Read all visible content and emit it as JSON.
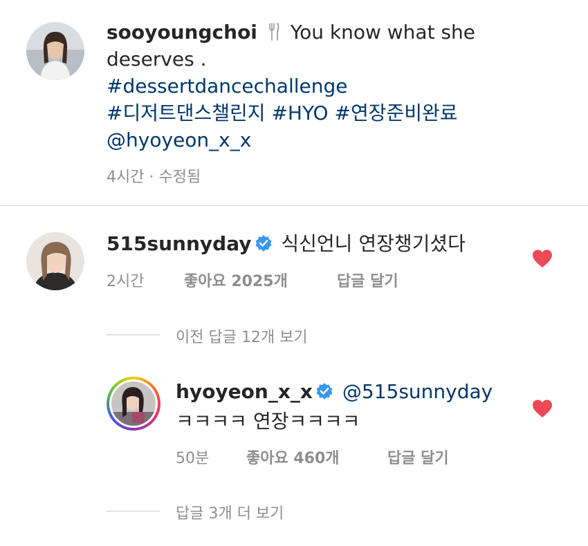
{
  "post": {
    "username": "sooyoungchoi",
    "text_1": "You know what she",
    "text_2": "deserves .",
    "hashtag_1": "#dessertdancechallenge",
    "hashtag_2": "#디저트댄스챌린지",
    "hashtag_3": "#HYO",
    "hashtag_4": "#연장준비완료",
    "mention": "@hyoyeon_x_x",
    "time": "4시간",
    "separator": "·",
    "edited": "수정됨"
  },
  "comment1": {
    "username": "515sunnyday",
    "text": "식신언니 연장챙기셨다",
    "time": "2시간",
    "likes_label": "좋아요 2025개",
    "reply_label": "답글 달기"
  },
  "view_previous": "이전 답글 12개 보기",
  "reply1": {
    "username": "hyoyeon_x_x",
    "mention": "@515sunnyday",
    "text": "ㅋㅋㅋㅋ 연장ㅋㅋㅋㅋ",
    "time": "50분",
    "likes_label": "좋아요 460개",
    "reply_label": "답글 달기"
  },
  "view_more": "답글 3개 더 보기",
  "icons": {
    "utensils": "fork-knife-icon",
    "verified": "verified-badge-icon",
    "heart": "heart-icon"
  },
  "colors": {
    "hashtag": "#00376b",
    "verified": "#3897f0",
    "heart": "#ed4956",
    "meta": "#8e8e8e"
  }
}
